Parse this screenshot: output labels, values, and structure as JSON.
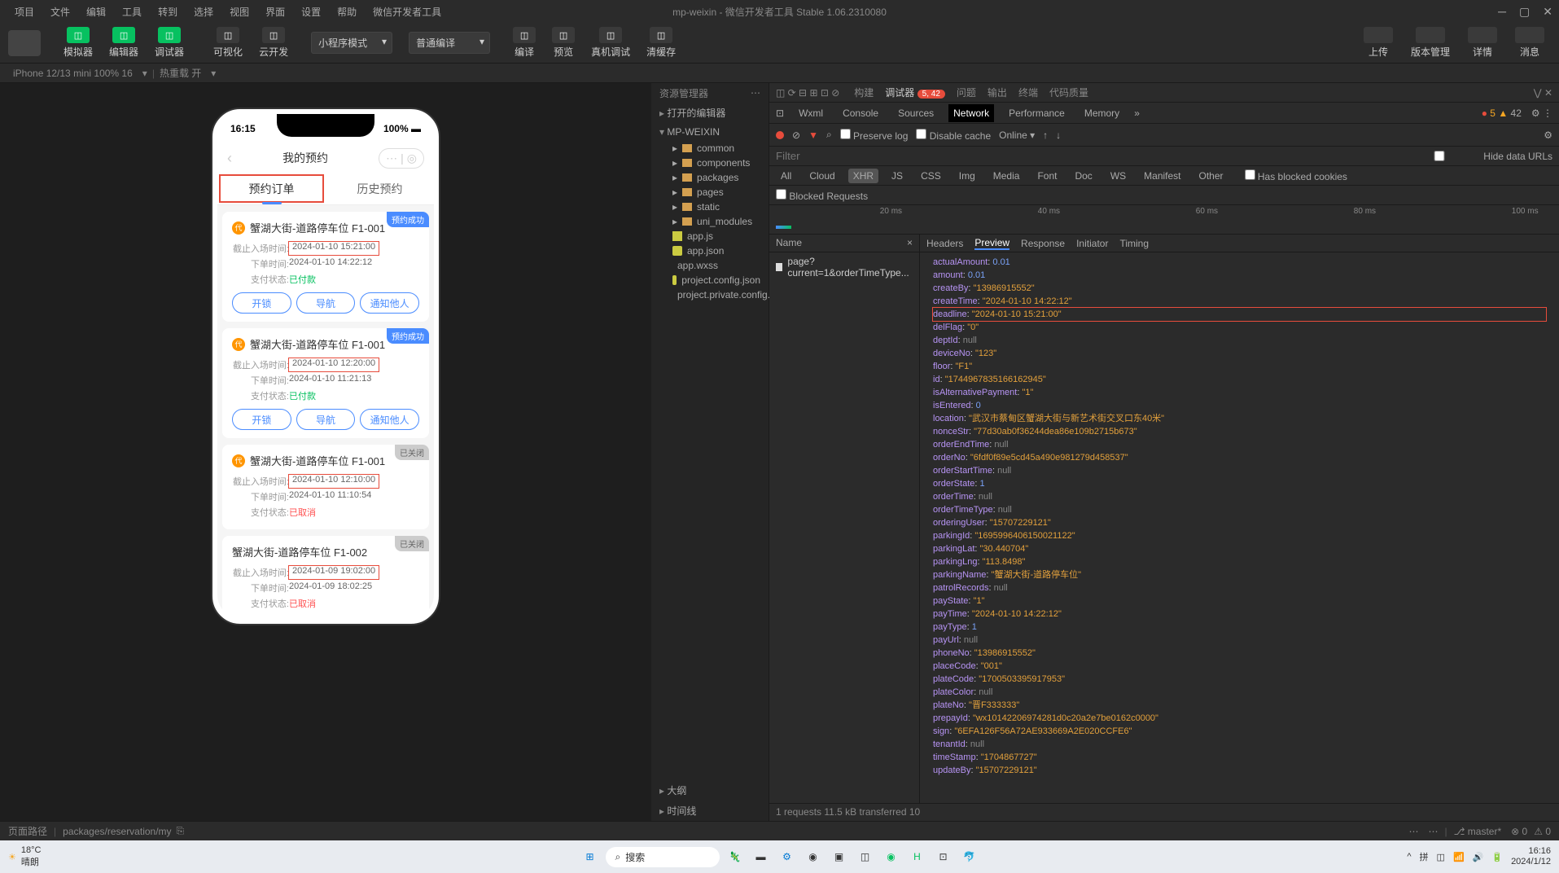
{
  "menubar": {
    "items": [
      "项目",
      "文件",
      "编辑",
      "工具",
      "转到",
      "选择",
      "视图",
      "界面",
      "设置",
      "帮助",
      "微信开发者工具"
    ],
    "title": "mp-weixin - 微信开发者工具 Stable 1.06.2310080"
  },
  "toolbar": {
    "mode_buttons": [
      {
        "label": "模拟器"
      },
      {
        "label": "编辑器"
      },
      {
        "label": "调试器"
      }
    ],
    "vis_buttons": [
      {
        "label": "可视化"
      },
      {
        "label": "云开发"
      }
    ],
    "mode_dropdown": "小程序模式",
    "compile_dropdown": "普通编译",
    "action_buttons": [
      {
        "label": "编译"
      },
      {
        "label": "预览"
      },
      {
        "label": "真机调试"
      },
      {
        "label": "清缓存"
      }
    ],
    "right_buttons": [
      {
        "label": "上传"
      },
      {
        "label": "版本管理"
      },
      {
        "label": "详情"
      },
      {
        "label": "消息"
      }
    ]
  },
  "subheader": {
    "device": "iPhone 12/13 mini 100% 16",
    "hotreload": "热重载 开"
  },
  "phone": {
    "time": "16:15",
    "battery": "100%",
    "nav_title": "我的预约",
    "tabs": [
      {
        "label": "预约订单",
        "active": true
      },
      {
        "label": "历史预约",
        "active": false
      }
    ],
    "orders": [
      {
        "badge": "预约成功",
        "badge_type": "blue",
        "has_icon": true,
        "title": "蟹湖大街-道路停车位 F1-001",
        "rows": [
          {
            "label": "截止入场时间:",
            "value": "2024-01-10 15:21:00",
            "annot": true
          },
          {
            "label": "下单时间:",
            "value": "2024-01-10 14:22:12"
          },
          {
            "label": "支付状态:",
            "value": "已付款",
            "class": "paid"
          }
        ],
        "actions": [
          "开锁",
          "导航",
          "通知他人"
        ]
      },
      {
        "badge": "预约成功",
        "badge_type": "blue",
        "has_icon": true,
        "title": "蟹湖大街-道路停车位 F1-001",
        "rows": [
          {
            "label": "截止入场时间:",
            "value": "2024-01-10 12:20:00",
            "annot": true
          },
          {
            "label": "下单时间:",
            "value": "2024-01-10 11:21:13"
          },
          {
            "label": "支付状态:",
            "value": "已付款",
            "class": "paid"
          }
        ],
        "actions": [
          "开锁",
          "导航",
          "通知他人"
        ]
      },
      {
        "badge": "已关闭",
        "badge_type": "gray",
        "has_icon": true,
        "title": "蟹湖大街-道路停车位 F1-001",
        "rows": [
          {
            "label": "截止入场时间:",
            "value": "2024-01-10 12:10:00",
            "annot": true
          },
          {
            "label": "下单时间:",
            "value": "2024-01-10 11:10:54"
          },
          {
            "label": "支付状态:",
            "value": "已取消",
            "class": "cancel"
          }
        ],
        "actions": []
      },
      {
        "badge": "已关闭",
        "badge_type": "gray",
        "has_icon": false,
        "title": "蟹湖大街-道路停车位 F1-002",
        "rows": [
          {
            "label": "截止入场时间:",
            "value": "2024-01-09 19:02:00",
            "annot": true
          },
          {
            "label": "下单时间:",
            "value": "2024-01-09 18:02:25"
          },
          {
            "label": "支付状态:",
            "value": "已取消",
            "class": "cancel"
          }
        ],
        "actions": []
      }
    ]
  },
  "resources": {
    "header": "资源管理器",
    "opened_editors": "打开的编辑器",
    "project": "MP-WEIXIN",
    "folders": [
      "common",
      "components",
      "packages",
      "pages",
      "static",
      "uni_modules"
    ],
    "files": [
      {
        "name": "app.js",
        "type": "js"
      },
      {
        "name": "app.json",
        "type": "json"
      },
      {
        "name": "app.wxss",
        "type": "file"
      },
      {
        "name": "project.config.json",
        "type": "json"
      },
      {
        "name": "project.private.config.js...",
        "type": "json"
      }
    ],
    "bottom_sections": [
      "大纲",
      "时间线"
    ]
  },
  "devtools": {
    "top_tabs": [
      "构建",
      "调试器",
      "问题",
      "输出",
      "终端",
      "代码质量"
    ],
    "top_badge": "5, 42",
    "inner_tabs": [
      "Wxml",
      "Console",
      "Sources",
      "Network",
      "Performance",
      "Memory"
    ],
    "warn_count": "5",
    "info_count": "42",
    "net_toolbar": {
      "preserve_log": "Preserve log",
      "disable_cache": "Disable cache",
      "online": "Online"
    },
    "filter": {
      "placeholder": "Filter",
      "hide_urls": "Hide data URLs"
    },
    "types": [
      "All",
      "Cloud",
      "XHR",
      "JS",
      "CSS",
      "Img",
      "Media",
      "Font",
      "Doc",
      "WS",
      "Manifest",
      "Other"
    ],
    "has_blocked": "Has blocked cookies",
    "blocked_requests": "Blocked Requests",
    "timeline_ticks": [
      "20 ms",
      "40 ms",
      "60 ms",
      "80 ms",
      "100 ms"
    ],
    "name_header": "Name",
    "requests": [
      "page?current=1&orderTimeType..."
    ],
    "detail_tabs": [
      "Headers",
      "Preview",
      "Response",
      "Initiator",
      "Timing"
    ],
    "preview_data": [
      {
        "key": "actualAmount",
        "val": "0.01",
        "type": "num"
      },
      {
        "key": "amount",
        "val": "0.01",
        "type": "num"
      },
      {
        "key": "createBy",
        "val": "\"13986915552\"",
        "type": "str"
      },
      {
        "key": "createTime",
        "val": "\"2024-01-10 14:22:12\"",
        "type": "str"
      },
      {
        "key": "deadline",
        "val": "\"2024-01-10 15:21:00\"",
        "type": "str",
        "annot": true
      },
      {
        "key": "delFlag",
        "val": "\"0\"",
        "type": "str"
      },
      {
        "key": "deptId",
        "val": "null",
        "type": "null"
      },
      {
        "key": "deviceNo",
        "val": "\"123\"",
        "type": "str"
      },
      {
        "key": "floor",
        "val": "\"F1\"",
        "type": "str"
      },
      {
        "key": "id",
        "val": "\"1744967835166162945\"",
        "type": "str"
      },
      {
        "key": "isAlternativePayment",
        "val": "\"1\"",
        "type": "str"
      },
      {
        "key": "isEntered",
        "val": "0",
        "type": "num"
      },
      {
        "key": "location",
        "val": "\"武汉市蔡甸区蟹湖大街与新艺术街交叉口东40米\"",
        "type": "str"
      },
      {
        "key": "nonceStr",
        "val": "\"77d30ab0f36244dea86e109b2715b673\"",
        "type": "str"
      },
      {
        "key": "orderEndTime",
        "val": "null",
        "type": "null"
      },
      {
        "key": "orderNo",
        "val": "\"6fdf0f89e5cd45a490e981279d458537\"",
        "type": "str"
      },
      {
        "key": "orderStartTime",
        "val": "null",
        "type": "null"
      },
      {
        "key": "orderState",
        "val": "1",
        "type": "num"
      },
      {
        "key": "orderTime",
        "val": "null",
        "type": "null"
      },
      {
        "key": "orderTimeType",
        "val": "null",
        "type": "null"
      },
      {
        "key": "orderingUser",
        "val": "\"15707229121\"",
        "type": "str"
      },
      {
        "key": "parkingId",
        "val": "\"1695996406150021122\"",
        "type": "str"
      },
      {
        "key": "parkingLat",
        "val": "\"30.440704\"",
        "type": "str"
      },
      {
        "key": "parkingLng",
        "val": "\"113.8498\"",
        "type": "str"
      },
      {
        "key": "parkingName",
        "val": "\"蟹湖大街-道路停车位\"",
        "type": "str"
      },
      {
        "key": "patrolRecords",
        "val": "null",
        "type": "null"
      },
      {
        "key": "payState",
        "val": "\"1\"",
        "type": "str"
      },
      {
        "key": "payTime",
        "val": "\"2024-01-10 14:22:12\"",
        "type": "str"
      },
      {
        "key": "payType",
        "val": "1",
        "type": "num"
      },
      {
        "key": "payUrl",
        "val": "null",
        "type": "null"
      },
      {
        "key": "phoneNo",
        "val": "\"13986915552\"",
        "type": "str"
      },
      {
        "key": "placeCode",
        "val": "\"001\"",
        "type": "str"
      },
      {
        "key": "plateCode",
        "val": "\"1700503395917953\"",
        "type": "str"
      },
      {
        "key": "plateColor",
        "val": "null",
        "type": "null"
      },
      {
        "key": "plateNo",
        "val": "\"晋F333333\"",
        "type": "str"
      },
      {
        "key": "prepayId",
        "val": "\"wx10142206974281d0c20a2e7be0162c0000\"",
        "type": "str"
      },
      {
        "key": "sign",
        "val": "\"6EFA126F56A72AE933669A2E020CCFE6\"",
        "type": "str"
      },
      {
        "key": "tenantId",
        "val": "null",
        "type": "null"
      },
      {
        "key": "timeStamp",
        "val": "\"1704867727\"",
        "type": "str"
      },
      {
        "key": "updateBy",
        "val": "\"15707229121\"",
        "type": "str"
      }
    ],
    "status": "1 requests   11.5 kB transferred   10"
  },
  "footer": {
    "page_path_label": "页面路径",
    "page_path": "packages/reservation/my",
    "branch": "master*",
    "errors": "0",
    "warnings": "0"
  },
  "taskbar": {
    "temp": "18°C",
    "weather": "晴朗",
    "search": "搜索",
    "time": "16:16",
    "date": "2024/1/12"
  }
}
